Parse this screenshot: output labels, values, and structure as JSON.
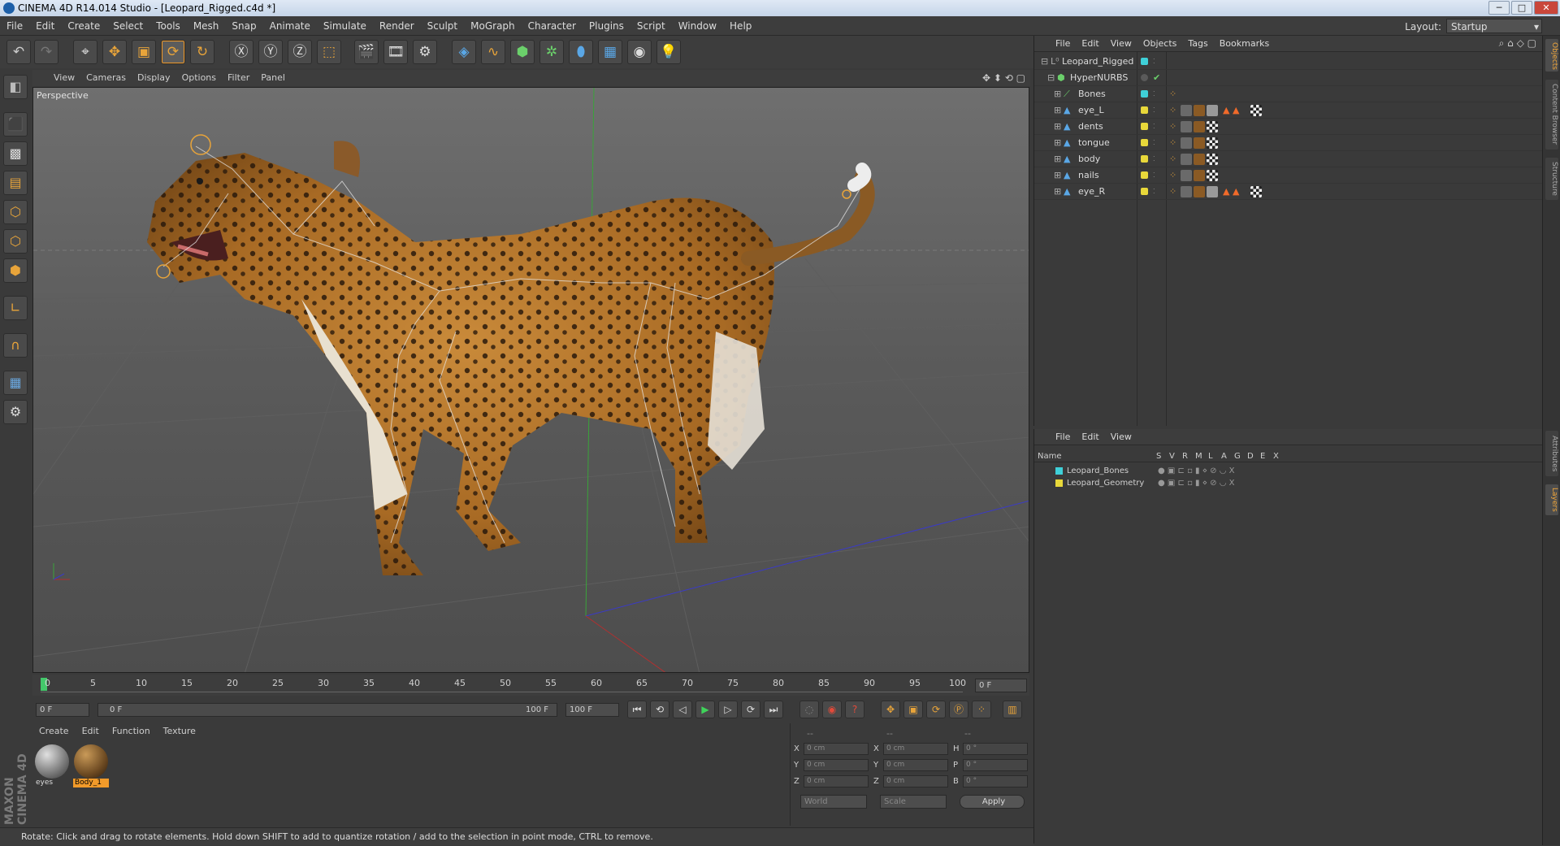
{
  "window": {
    "title": "CINEMA 4D R14.014 Studio - [Leopard_Rigged.c4d *]",
    "minimize": "─",
    "maximize": "□",
    "close": "✕"
  },
  "menubar": {
    "items": [
      "File",
      "Edit",
      "Create",
      "Select",
      "Tools",
      "Mesh",
      "Snap",
      "Animate",
      "Simulate",
      "Render",
      "Sculpt",
      "MoGraph",
      "Character",
      "Plugins",
      "Script",
      "Window",
      "Help"
    ],
    "layout_label": "Layout:",
    "layout_value": "Startup"
  },
  "viewport": {
    "menu": [
      "View",
      "Cameras",
      "Display",
      "Options",
      "Filter",
      "Panel"
    ],
    "label": "Perspective"
  },
  "timeline": {
    "ticks": [
      "0",
      "5",
      "10",
      "15",
      "20",
      "25",
      "30",
      "35",
      "40",
      "45",
      "50",
      "55",
      "60",
      "65",
      "70",
      "75",
      "80",
      "85",
      "90",
      "95",
      "100"
    ],
    "current_frame": "0 F"
  },
  "transport": {
    "start_field": "0 F",
    "range_start": "0 F",
    "range_end": "100 F",
    "end_field": "100 F"
  },
  "materials": {
    "menu": [
      "Create",
      "Edit",
      "Function",
      "Texture"
    ],
    "items": [
      {
        "label": "eyes",
        "selected": false
      },
      {
        "label": "Body_1",
        "selected": true
      }
    ]
  },
  "coordinates": {
    "header_a": "--",
    "header_b": "--",
    "header_c": "--",
    "rows": [
      {
        "a_axis": "X",
        "a_val": "0 cm",
        "b_axis": "X",
        "b_val": "0 cm",
        "c_axis": "H",
        "c_val": "0 °"
      },
      {
        "a_axis": "Y",
        "a_val": "0 cm",
        "b_axis": "Y",
        "b_val": "0 cm",
        "c_axis": "P",
        "c_val": "0 °"
      },
      {
        "a_axis": "Z",
        "a_val": "0 cm",
        "b_axis": "Z",
        "b_val": "0 cm",
        "c_axis": "B",
        "c_val": "0 °"
      }
    ],
    "mode_world": "World",
    "mode_scale": "Scale",
    "apply": "Apply"
  },
  "status": "Rotate: Click and drag to rotate elements. Hold down SHIFT to add to quantize rotation / add to the selection in point mode, CTRL to remove.",
  "brand": "MAXON CINEMA 4D",
  "object_manager": {
    "menu": [
      "File",
      "Edit",
      "View",
      "Objects",
      "Tags",
      "Bookmarks"
    ],
    "objects": [
      {
        "name": "Leopard_Rigged",
        "level": 0,
        "color": "#3fd0d8"
      },
      {
        "name": "HyperNURBS",
        "level": 1,
        "color": "#5a5a5a"
      },
      {
        "name": "Bones",
        "level": 2,
        "color": "#3fd0d8"
      },
      {
        "name": "eye_L",
        "level": 2,
        "color": "#e8d83a"
      },
      {
        "name": "dents",
        "level": 2,
        "color": "#e8d83a"
      },
      {
        "name": "tongue",
        "level": 2,
        "color": "#e8d83a"
      },
      {
        "name": "body",
        "level": 2,
        "color": "#e8d83a"
      },
      {
        "name": "nails",
        "level": 2,
        "color": "#e8d83a"
      },
      {
        "name": "eye_R",
        "level": 2,
        "color": "#e8d83a"
      }
    ]
  },
  "layer_manager": {
    "menu": [
      "File",
      "Edit",
      "View"
    ],
    "columns": [
      "Name",
      "S",
      "V",
      "R",
      "M",
      "L",
      "A",
      "G",
      "D",
      "E",
      "X"
    ],
    "layers": [
      {
        "name": "Leopard_Bones",
        "color": "#3fd0d8"
      },
      {
        "name": "Leopard_Geometry",
        "color": "#e8d83a"
      }
    ]
  },
  "right_tabs": [
    "Objects",
    "Content Browser",
    "Structure",
    "Attributes",
    "Layers"
  ],
  "colors": {
    "accent": "#f19a2a",
    "panel": "#3a3a3a",
    "cyan_layer": "#3fd0d8",
    "yellow_layer": "#e8d83a"
  }
}
